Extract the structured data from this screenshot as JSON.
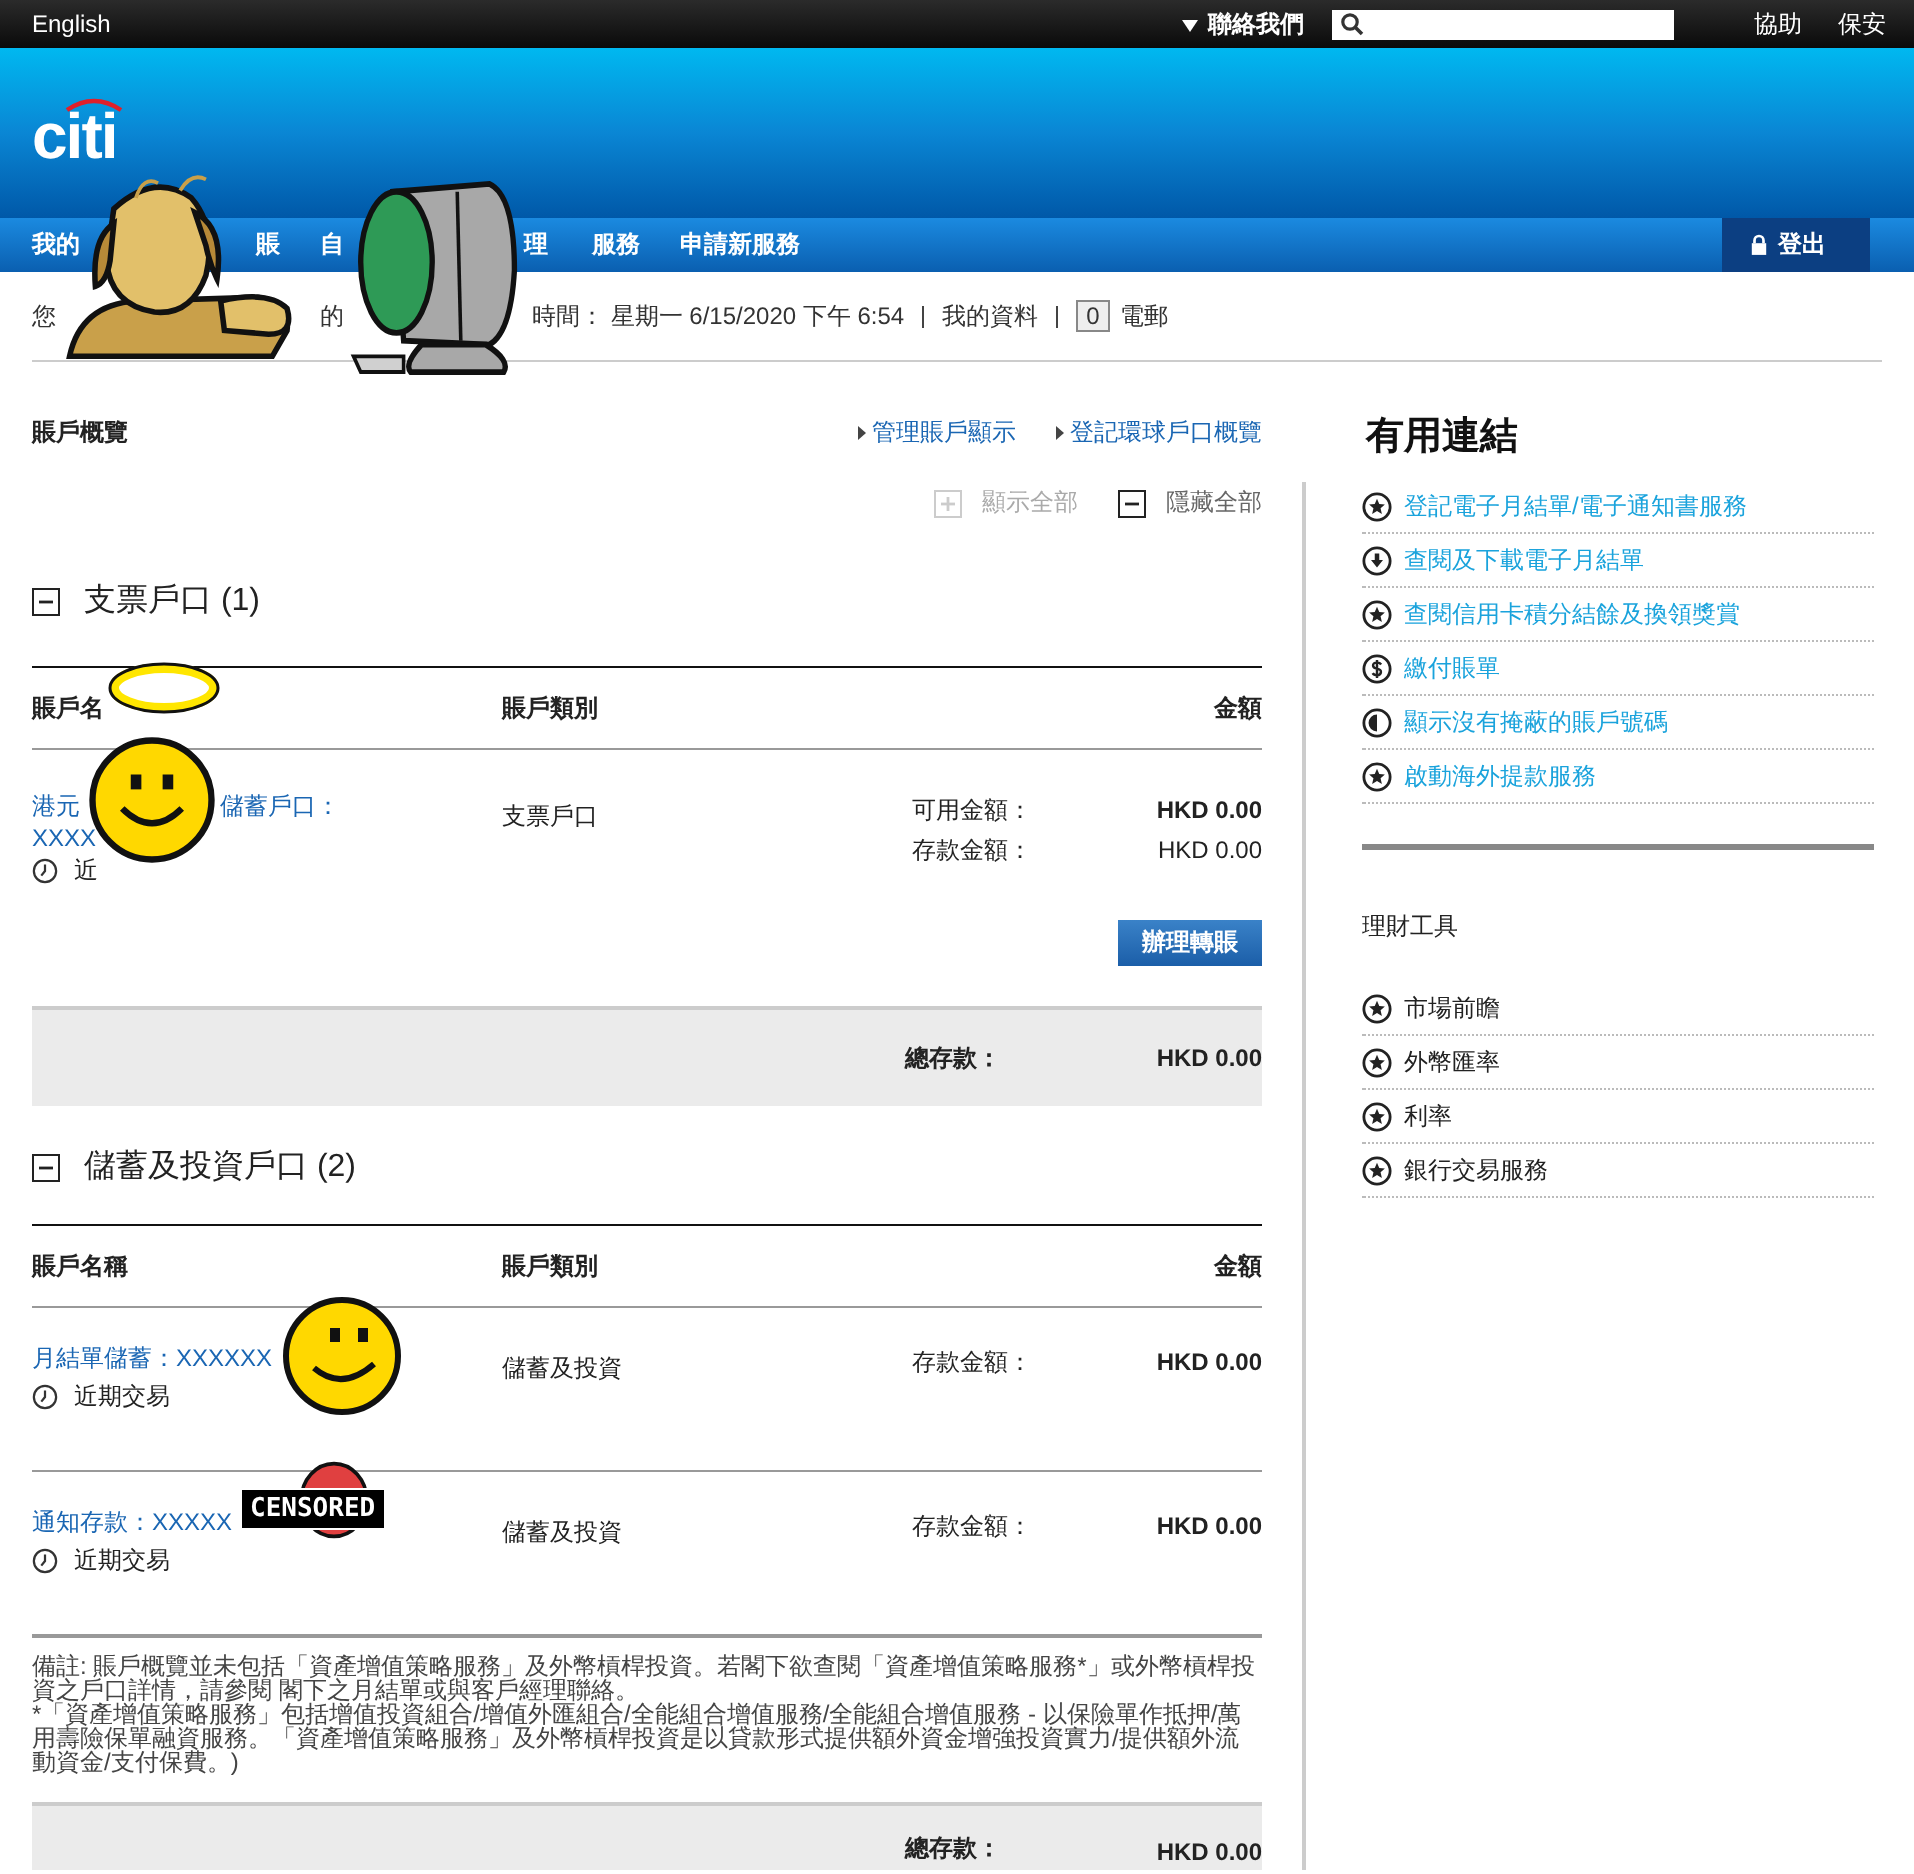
{
  "top_bar": {
    "language": "English",
    "contact": "聯絡我們",
    "links": [
      "協助",
      "保安"
    ]
  },
  "logo": "citi",
  "nav": {
    "items": [
      "我的",
      "賬",
      "自",
      "理",
      "服務",
      "申請新服務"
    ],
    "logout": "登出"
  },
  "greeting": {
    "fragments": [
      "您",
      "的"
    ],
    "time": "時間： 星期一 6/15/2020 下午 6:54",
    "profile": "我的資料",
    "mail_count": "0",
    "mail": "電郵"
  },
  "overview": {
    "title": "賬戶概覽",
    "links": [
      "管理賬戶顯示",
      "登記環球戶口概覽"
    ],
    "toggles": [
      {
        "label": "顯示全部",
        "kind": "expand",
        "disabled": true
      },
      {
        "label": "隱藏全部",
        "kind": "collapse",
        "disabled": false
      }
    ]
  },
  "sections": [
    {
      "title": "支票戶口 (1)",
      "expanded": true,
      "columns": [
        "賬戶名",
        "賬戶類別",
        "金額"
      ],
      "rows": [
        {
          "name_parts": [
            "港元",
            "儲蓄戶口："
          ],
          "number": "XXXX",
          "history": "近",
          "type": "支票戶口",
          "amounts": [
            {
              "label": "可用金額：",
              "value": "HKD 0.00",
              "bold": true
            },
            {
              "label": "存款金額：",
              "value": "HKD 0.00",
              "bold": false
            }
          ]
        }
      ],
      "action": "辦理轉賬",
      "total_label": "總存款：",
      "total": "HKD 0.00"
    },
    {
      "title": "儲蓄及投資戶口 (2)",
      "expanded": true,
      "columns": [
        "賬戶名稱",
        "賬戶類別",
        "金額"
      ],
      "rows": [
        {
          "name_parts": [
            "月結單儲蓄：XXXXXX"
          ],
          "history": "近期交易",
          "type": "儲蓄及投資",
          "amounts": [
            {
              "label": "存款金額：",
              "value": "HKD 0.00",
              "bold": true
            }
          ]
        },
        {
          "name_parts": [
            "通知存款：XXXXX"
          ],
          "history": "近期交易",
          "type": "儲蓄及投資",
          "amounts": [
            {
              "label": "存款金額：",
              "value": "HKD 0.00",
              "bold": true
            }
          ]
        }
      ],
      "note": [
        "備註: 賬戶概覽並未包括「資產增值策略服務」及外幣槓桿投資。若閣下欲查閱「資產增值策略服務*」或外幣槓桿投資之戶口詳情，請參閱 閣下之月結單或與客戶經理聯絡。",
        "*「資產增值策略服務」包括增值投資組合/增值外匯組合/全能組合增值服務/全能組合增值服務 - 以保險單作抵押/萬用壽險保單融資服務。「資產增值策略服務」及外幣槓桿投資是以貸款形式提供額外資金增強投資實力/提供額外流動資金/支付保費。)"
      ],
      "total_label": "總存款：",
      "total": "HKD 0.00"
    }
  ],
  "useful_links": {
    "title": "有用連結",
    "items": [
      {
        "label": "登記電子月結單/電子通知書服務",
        "kind": "star"
      },
      {
        "label": "查閱及下載電子月結單",
        "kind": "download"
      },
      {
        "label": "查閱信用卡積分結餘及換領獎賞",
        "kind": "star"
      },
      {
        "label": "繳付賬單",
        "kind": "dollar"
      },
      {
        "label": "顯示沒有掩蔽的賬戶號碼",
        "kind": "half"
      },
      {
        "label": "啟動海外提款服務",
        "kind": "star"
      }
    ]
  },
  "tools": {
    "title": "理財工具",
    "items": [
      {
        "label": "市場前瞻",
        "kind": "star"
      },
      {
        "label": "外幣匯率",
        "kind": "star"
      },
      {
        "label": "利率",
        "kind": "star"
      },
      {
        "label": "銀行交易服務",
        "kind": "star"
      }
    ]
  },
  "censor_sticker": {
    "text": "CENSORED"
  }
}
